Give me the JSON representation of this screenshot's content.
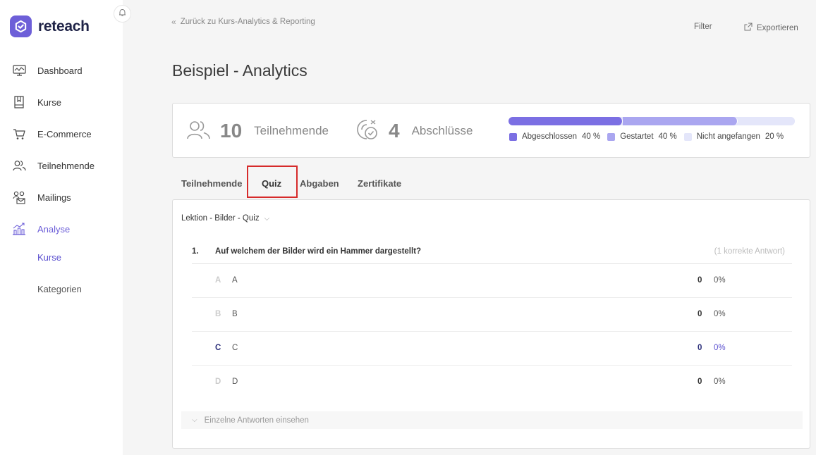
{
  "brand": {
    "name": "reteach",
    "accent": "#6d5fd8"
  },
  "sidebar": {
    "items": [
      {
        "label": "Dashboard",
        "icon": "dashboard-icon"
      },
      {
        "label": "Kurse",
        "icon": "book-icon"
      },
      {
        "label": "E-Commerce",
        "icon": "cart-icon"
      },
      {
        "label": "Teilnehmende",
        "icon": "users-icon"
      },
      {
        "label": "Mailings",
        "icon": "mailing-icon"
      },
      {
        "label": "Analyse",
        "icon": "analytics-icon"
      }
    ],
    "sub_items": [
      {
        "label": "Kurse"
      },
      {
        "label": "Kategorien"
      }
    ]
  },
  "header": {
    "back_link": "Zurück zu Kurs-Analytics & Reporting",
    "filter_label": "Filter",
    "export_label": "Exportieren",
    "title": "Beispiel - Analytics"
  },
  "stats": {
    "participants_count": "10",
    "participants_label": "Teilnehmende",
    "completions_count": "4",
    "completions_label": "Abschlüsse",
    "progress": [
      {
        "label": "Abgeschlossen",
        "pct_text": "40 %",
        "value": 40,
        "color": "#7b6fe3"
      },
      {
        "label": "Gestartet",
        "pct_text": "40 %",
        "value": 40,
        "color": "#aaa6f0"
      },
      {
        "label": "Nicht angefangen",
        "pct_text": "20 %",
        "value": 20,
        "color": "#e4e6fa"
      }
    ]
  },
  "tabs": [
    {
      "label": "Teilnehmende"
    },
    {
      "label": "Quiz"
    },
    {
      "label": "Abgaben"
    },
    {
      "label": "Zertifikate"
    }
  ],
  "quiz": {
    "lesson_select": "Lektion - Bilder - Quiz",
    "question": {
      "number": "1.",
      "text": "Auf welchem der Bilder wird ein Hammer dargestellt?",
      "note": "(1 korrekte Antwort)"
    },
    "answers": [
      {
        "letter": "A",
        "text": "A",
        "count": "0",
        "pct": "0%",
        "correct": false
      },
      {
        "letter": "B",
        "text": "B",
        "count": "0",
        "pct": "0%",
        "correct": false
      },
      {
        "letter": "C",
        "text": "C",
        "count": "0",
        "pct": "0%",
        "correct": true
      },
      {
        "letter": "D",
        "text": "D",
        "count": "0",
        "pct": "0%",
        "correct": false
      }
    ],
    "details_label": "Einzelne Antworten einsehen"
  }
}
